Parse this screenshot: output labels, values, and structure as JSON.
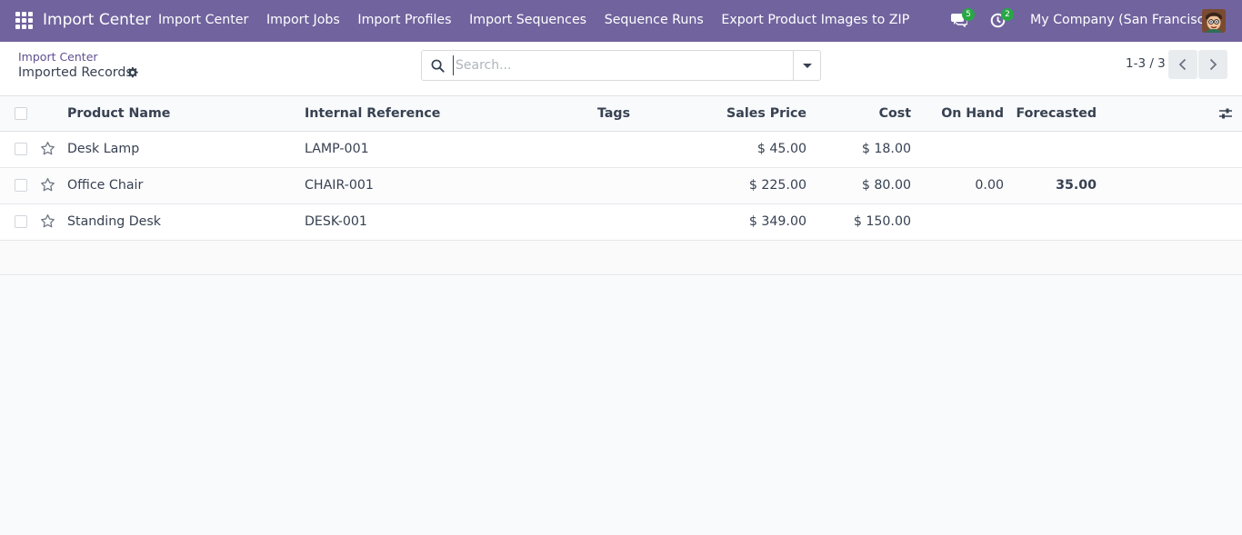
{
  "navbar": {
    "brand": "Import Center",
    "menu": [
      "Import Center",
      "Import Jobs",
      "Import Profiles",
      "Import Sequences",
      "Sequence Runs",
      "Export Product Images to ZIP"
    ],
    "messages_count": "5",
    "activities_count": "2",
    "company": "My Company (San Francisco)",
    "accent_color": "#71639e"
  },
  "breadcrumb": {
    "parent": "Import Center",
    "current": "Imported Records"
  },
  "search": {
    "placeholder": "Search...",
    "value": ""
  },
  "pager": {
    "value": "1-3 / 3"
  },
  "table": {
    "columns": [
      "Product Name",
      "Internal Reference",
      "Tags",
      "Sales Price",
      "Cost",
      "On Hand",
      "Forecasted"
    ],
    "rows": [
      {
        "name": "Desk Lamp",
        "ref": "LAMP-001",
        "tags": "",
        "price": "$ 45.00",
        "cost": "$ 18.00",
        "on_hand": "",
        "forecasted": ""
      },
      {
        "name": "Office Chair",
        "ref": "CHAIR-001",
        "tags": "",
        "price": "$ 225.00",
        "cost": "$ 80.00",
        "on_hand": "0.00",
        "forecasted": "35.00"
      },
      {
        "name": "Standing Desk",
        "ref": "DESK-001",
        "tags": "",
        "price": "$ 349.00",
        "cost": "$ 150.00",
        "on_hand": "",
        "forecasted": ""
      }
    ]
  }
}
